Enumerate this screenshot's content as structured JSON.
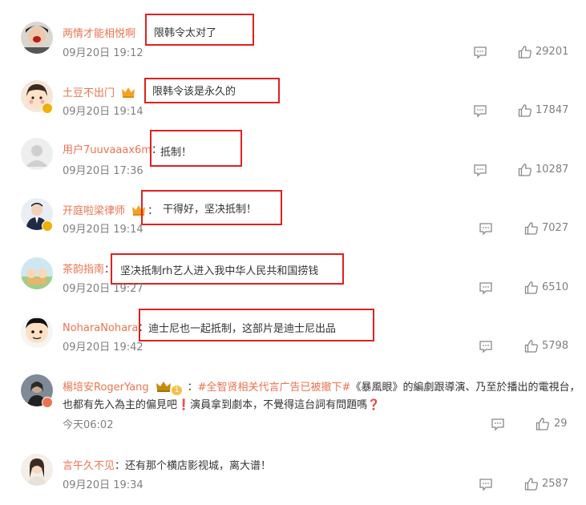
{
  "colors": {
    "name": "#eb7350",
    "highlight_box": "#e02020",
    "meta": "#808080"
  },
  "comments": [
    {
      "user": "两情才能相悦啊",
      "text": "限韩令太对了",
      "time": "09月20日 19:12",
      "likes": "29201"
    },
    {
      "user": "土豆不出门",
      "text": "限韩令该是永久的",
      "time": "09月20日 19:14",
      "likes": "17847"
    },
    {
      "user": "用户7uuvaaax6m",
      "text": "抵制！",
      "time": "09月20日 17:36",
      "likes": "10287"
    },
    {
      "user": "开庭啦梁律师",
      "text": "干得好，坚决抵制！",
      "time": "09月20日 19:14",
      "likes": "7027"
    },
    {
      "user": "茶韵指南",
      "text": "坚决抵制rh艺人进入我中华人民共和国捞钱",
      "time": "09月20日 19:27",
      "likes": "6510"
    },
    {
      "user": "NoharaNohara",
      "text": "迪士尼也一起抵制，这部片是迪士尼出品",
      "time": "09月20日 19:42",
      "likes": "5798"
    },
    {
      "user": "楊培安RogerYang",
      "badge_level": "1",
      "tag": "#全智贤相关代言广告已被撤下#",
      "text": "《暴風眼》的編劇跟導演、乃至於播出的電視台，也都有先入為主的偏見吧❗演員拿到劇本，不覺得這台詞有問題嗎❓",
      "time": "今天06:02",
      "likes": "29"
    },
    {
      "user": "言午久不见",
      "text": "还有那个横店影视城，离大谱！",
      "time": "09月20日 19:34",
      "likes": "2587"
    }
  ]
}
